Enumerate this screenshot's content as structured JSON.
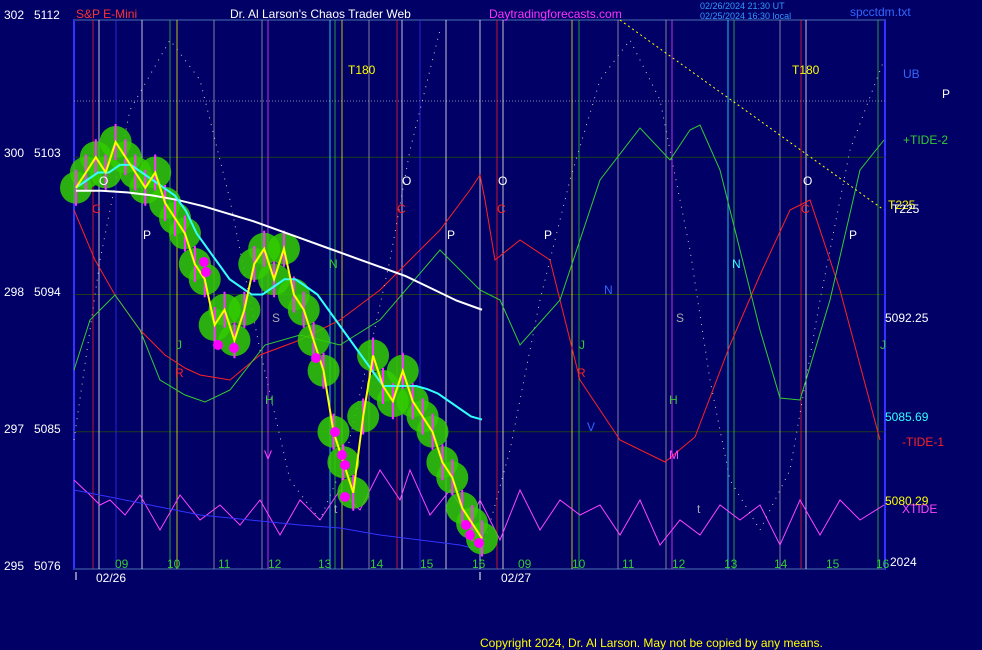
{
  "header": {
    "scale_top_left": "302",
    "price_top_left": "5112",
    "symbol": "S&P E-Mini",
    "title": "Dr. Al Larson's Chaos Trader Web",
    "site": "Daytradingforecasts.com",
    "timestamp1": "02/26/2024 21:30 UT",
    "timestamp2": "02/25/2024 16:30 local",
    "file": "spcctdm.txt"
  },
  "left_axis": {
    "rows": [
      {
        "scale": "302",
        "price": "5112"
      },
      {
        "scale": "300",
        "price": "5103"
      },
      {
        "scale": "298",
        "price": "5094"
      },
      {
        "scale": "297",
        "price": "5085"
      },
      {
        "scale": "295",
        "price": "5076"
      }
    ]
  },
  "right_labels": {
    "ub": "UB",
    "p": "P",
    "tide2": "+TIDE-2",
    "t225a": "T225",
    "t225b": "T225",
    "price1": "5092.25",
    "price2": "5085.69",
    "tide1": "-TIDE-1",
    "price3": "5080.29",
    "xtide": "XTIDE",
    "year": "2024"
  },
  "x_axis": {
    "hours": [
      "09",
      "10",
      "11",
      "12",
      "13",
      "14",
      "15",
      "16",
      "09",
      "10",
      "11",
      "12",
      "13",
      "14",
      "15",
      "16"
    ],
    "dates": [
      "02/26",
      "02/27"
    ]
  },
  "markers": {
    "t180a": "T180",
    "t180b": "T180",
    "o": "O",
    "p": "P",
    "j": "J",
    "h": "H",
    "s": "S",
    "n": "N",
    "m": "M",
    "r": "R",
    "v": "V",
    "t": "t",
    "c": "C"
  },
  "copyright": "Copyright 2024, Dr. Al Larson. May not be copied by any means.",
  "colors": {
    "background": "#000066",
    "price": "#ffff00",
    "bars": "#ff33ff",
    "halo": "#33cc00",
    "ma_fast": "#33ffff",
    "ma_slow": "#ffffff",
    "tide_red": "#ff2222",
    "tide_green": "#33cc33",
    "xtide": "#ff44ff",
    "border": "#3333ff",
    "dots": "#ff00ff"
  },
  "chart_data": {
    "type": "line",
    "ylim": [
      5076,
      5112
    ],
    "yticks": [
      5112,
      5103,
      5094,
      5085,
      5076
    ],
    "series": [
      {
        "values": [
          5101,
          5102,
          5103,
          5102,
          5104,
          5103,
          5102,
          5101,
          5102,
          5100,
          5099,
          5098,
          5096,
          5095,
          5092,
          5093,
          5091,
          5093,
          5096,
          5097,
          5095,
          5097,
          5094,
          5093,
          5091,
          5089,
          5085,
          5083,
          5081,
          5086,
          5090,
          5088,
          5087,
          5089,
          5087,
          5086,
          5085,
          5083,
          5082,
          5080,
          5079,
          5078
        ]
      },
      {
        "values": [
          5101,
          5101.5,
          5102,
          5102,
          5102.5,
          5102.5,
          5102,
          5101.5,
          5101,
          5100.5,
          5099.5,
          5098,
          5097,
          5096,
          5095,
          5094.5,
          5094,
          5094,
          5094.5,
          5095,
          5095,
          5094.5,
          5094,
          5093,
          5092,
          5091,
          5090,
          5089,
          5088,
          5088,
          5088,
          5088,
          5087.8,
          5087.5,
          5087,
          5086.5,
          5086,
          5085.8
        ]
      },
      {
        "values": [
          5100.8,
          5100.8,
          5100.7,
          5100.5,
          5100.2,
          5099.8,
          5099.3,
          5098.8,
          5098.2,
          5097.6,
          5097,
          5096.4,
          5095.8,
          5095.2,
          5094.4,
          5093.6,
          5093
        ]
      }
    ]
  }
}
